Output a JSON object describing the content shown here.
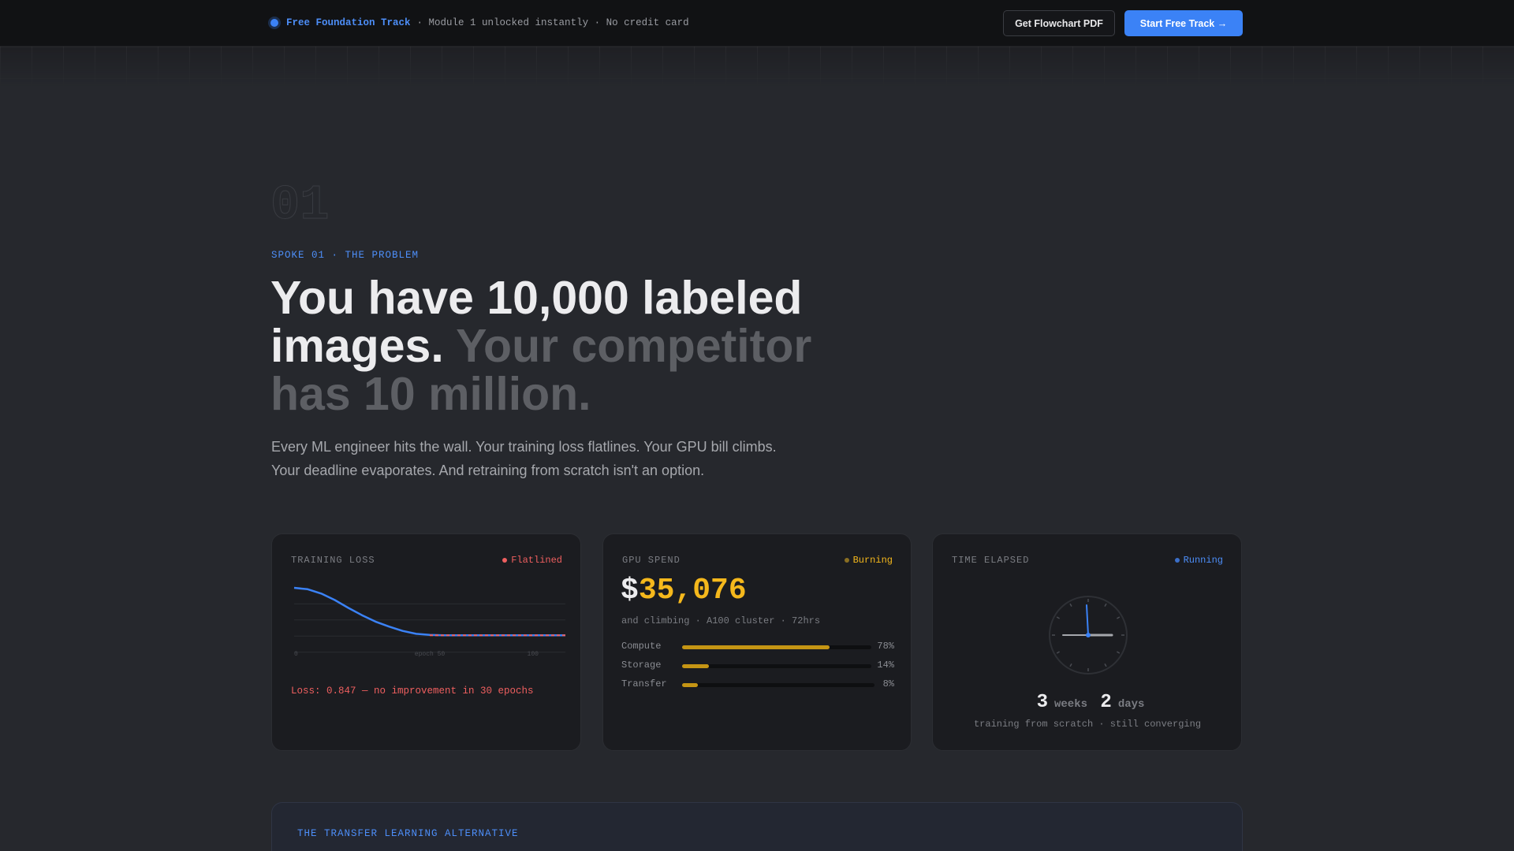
{
  "topbar": {
    "track_name": "Free Foundation Track",
    "track_meta": "· Module 1 unlocked instantly · No credit card",
    "pdf_button": "Get Flowchart PDF",
    "start_button": "Start Free Track →"
  },
  "hero": {
    "number": "01",
    "eyebrow": "SPOKE 01 · THE PROBLEM",
    "headline_main": "You have 10,000 labeled images.",
    "headline_muted": "Your competitor has 10 million.",
    "subtitle_line1": "Every ML engineer hits the wall. Your training loss flatlines. Your GPU bill climbs.",
    "subtitle_line2": "Your deadline evaporates. And retraining from scratch isn't an option."
  },
  "cards": {
    "loss": {
      "title": "TRAINING LOSS",
      "status": "Flatlined",
      "status_color": "#ef5f5f",
      "note": "Loss: 0.847 — no improvement in 30 epochs"
    },
    "gpu": {
      "title": "GPU SPEND",
      "status": "Burning",
      "status_color": "#f5b81c",
      "currency": "$",
      "amount": "35,076",
      "subtitle": "and climbing · A100 cluster · 72hrs",
      "bars": [
        {
          "label": "Compute",
          "value": 78,
          "pct": "78%"
        },
        {
          "label": "Storage",
          "value": 14,
          "pct": "14%"
        },
        {
          "label": "Transfer",
          "value": 8,
          "pct": "8%"
        }
      ]
    },
    "time": {
      "title": "TIME ELAPSED",
      "status": "Running",
      "status_color": "#4d8ef8",
      "weeks": "3",
      "weeks_label": "weeks",
      "days": "2",
      "days_label": "days",
      "subtitle": "training from scratch · still converging"
    }
  },
  "chart_data": {
    "type": "line",
    "title": "TRAINING LOSS",
    "x_ticks": [
      "0",
      "epoch 50",
      "100"
    ],
    "series": [
      {
        "x": [
          0,
          5,
          10,
          15,
          20,
          25,
          30,
          35,
          40,
          45,
          50,
          55,
          60,
          70,
          80,
          90,
          100
        ],
        "y": [
          1.0,
          0.98,
          0.92,
          0.83,
          0.72,
          0.62,
          0.53,
          0.46,
          0.4,
          0.36,
          0.345,
          0.34,
          0.34,
          0.34,
          0.34,
          0.34,
          0.34
        ]
      }
    ],
    "plateau_from": 50,
    "grid": true
  },
  "alternative": {
    "title": "THE TRANSFER LEARNING ALTERNATIVE"
  },
  "colors": {
    "accent": "#3b82f6",
    "warning": "#f5b81c",
    "danger": "#ef5f5f"
  }
}
